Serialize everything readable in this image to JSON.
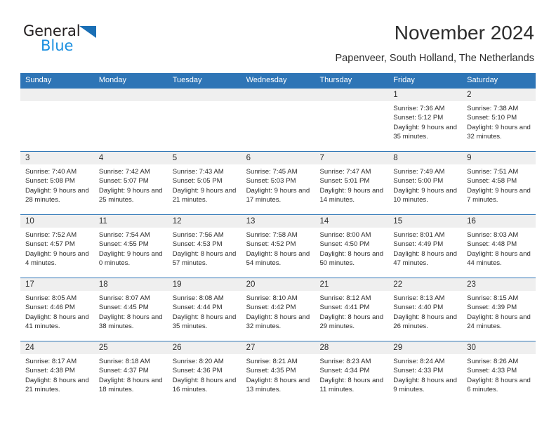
{
  "brand": {
    "name_part1": "General",
    "name_part2": "Blue",
    "triangle_icon": "triangle-icon",
    "color_dark": "#231f20",
    "color_blue": "#1a8fe0",
    "color_triangle": "#1a6fb5"
  },
  "header": {
    "title": "November 2024",
    "subtitle": "Papenveer, South Holland, The Netherlands"
  },
  "theme": {
    "header_bg": "#2e75b6",
    "date_strip_bg": "#efefef",
    "text": "#2c2c2c"
  },
  "weekdays": [
    "Sunday",
    "Monday",
    "Tuesday",
    "Wednesday",
    "Thursday",
    "Friday",
    "Saturday"
  ],
  "weeks": [
    [
      {
        "date": "",
        "sunrise": "",
        "sunset": "",
        "daylight": "",
        "empty": true
      },
      {
        "date": "",
        "sunrise": "",
        "sunset": "",
        "daylight": "",
        "empty": true
      },
      {
        "date": "",
        "sunrise": "",
        "sunset": "",
        "daylight": "",
        "empty": true
      },
      {
        "date": "",
        "sunrise": "",
        "sunset": "",
        "daylight": "",
        "empty": true
      },
      {
        "date": "",
        "sunrise": "",
        "sunset": "",
        "daylight": "",
        "empty": true
      },
      {
        "date": "1",
        "sunrise": "Sunrise: 7:36 AM",
        "sunset": "Sunset: 5:12 PM",
        "daylight": "Daylight: 9 hours and 35 minutes.",
        "empty": false
      },
      {
        "date": "2",
        "sunrise": "Sunrise: 7:38 AM",
        "sunset": "Sunset: 5:10 PM",
        "daylight": "Daylight: 9 hours and 32 minutes.",
        "empty": false
      }
    ],
    [
      {
        "date": "3",
        "sunrise": "Sunrise: 7:40 AM",
        "sunset": "Sunset: 5:08 PM",
        "daylight": "Daylight: 9 hours and 28 minutes.",
        "empty": false
      },
      {
        "date": "4",
        "sunrise": "Sunrise: 7:42 AM",
        "sunset": "Sunset: 5:07 PM",
        "daylight": "Daylight: 9 hours and 25 minutes.",
        "empty": false
      },
      {
        "date": "5",
        "sunrise": "Sunrise: 7:43 AM",
        "sunset": "Sunset: 5:05 PM",
        "daylight": "Daylight: 9 hours and 21 minutes.",
        "empty": false
      },
      {
        "date": "6",
        "sunrise": "Sunrise: 7:45 AM",
        "sunset": "Sunset: 5:03 PM",
        "daylight": "Daylight: 9 hours and 17 minutes.",
        "empty": false
      },
      {
        "date": "7",
        "sunrise": "Sunrise: 7:47 AM",
        "sunset": "Sunset: 5:01 PM",
        "daylight": "Daylight: 9 hours and 14 minutes.",
        "empty": false
      },
      {
        "date": "8",
        "sunrise": "Sunrise: 7:49 AM",
        "sunset": "Sunset: 5:00 PM",
        "daylight": "Daylight: 9 hours and 10 minutes.",
        "empty": false
      },
      {
        "date": "9",
        "sunrise": "Sunrise: 7:51 AM",
        "sunset": "Sunset: 4:58 PM",
        "daylight": "Daylight: 9 hours and 7 minutes.",
        "empty": false
      }
    ],
    [
      {
        "date": "10",
        "sunrise": "Sunrise: 7:52 AM",
        "sunset": "Sunset: 4:57 PM",
        "daylight": "Daylight: 9 hours and 4 minutes.",
        "empty": false
      },
      {
        "date": "11",
        "sunrise": "Sunrise: 7:54 AM",
        "sunset": "Sunset: 4:55 PM",
        "daylight": "Daylight: 9 hours and 0 minutes.",
        "empty": false
      },
      {
        "date": "12",
        "sunrise": "Sunrise: 7:56 AM",
        "sunset": "Sunset: 4:53 PM",
        "daylight": "Daylight: 8 hours and 57 minutes.",
        "empty": false
      },
      {
        "date": "13",
        "sunrise": "Sunrise: 7:58 AM",
        "sunset": "Sunset: 4:52 PM",
        "daylight": "Daylight: 8 hours and 54 minutes.",
        "empty": false
      },
      {
        "date": "14",
        "sunrise": "Sunrise: 8:00 AM",
        "sunset": "Sunset: 4:50 PM",
        "daylight": "Daylight: 8 hours and 50 minutes.",
        "empty": false
      },
      {
        "date": "15",
        "sunrise": "Sunrise: 8:01 AM",
        "sunset": "Sunset: 4:49 PM",
        "daylight": "Daylight: 8 hours and 47 minutes.",
        "empty": false
      },
      {
        "date": "16",
        "sunrise": "Sunrise: 8:03 AM",
        "sunset": "Sunset: 4:48 PM",
        "daylight": "Daylight: 8 hours and 44 minutes.",
        "empty": false
      }
    ],
    [
      {
        "date": "17",
        "sunrise": "Sunrise: 8:05 AM",
        "sunset": "Sunset: 4:46 PM",
        "daylight": "Daylight: 8 hours and 41 minutes.",
        "empty": false
      },
      {
        "date": "18",
        "sunrise": "Sunrise: 8:07 AM",
        "sunset": "Sunset: 4:45 PM",
        "daylight": "Daylight: 8 hours and 38 minutes.",
        "empty": false
      },
      {
        "date": "19",
        "sunrise": "Sunrise: 8:08 AM",
        "sunset": "Sunset: 4:44 PM",
        "daylight": "Daylight: 8 hours and 35 minutes.",
        "empty": false
      },
      {
        "date": "20",
        "sunrise": "Sunrise: 8:10 AM",
        "sunset": "Sunset: 4:42 PM",
        "daylight": "Daylight: 8 hours and 32 minutes.",
        "empty": false
      },
      {
        "date": "21",
        "sunrise": "Sunrise: 8:12 AM",
        "sunset": "Sunset: 4:41 PM",
        "daylight": "Daylight: 8 hours and 29 minutes.",
        "empty": false
      },
      {
        "date": "22",
        "sunrise": "Sunrise: 8:13 AM",
        "sunset": "Sunset: 4:40 PM",
        "daylight": "Daylight: 8 hours and 26 minutes.",
        "empty": false
      },
      {
        "date": "23",
        "sunrise": "Sunrise: 8:15 AM",
        "sunset": "Sunset: 4:39 PM",
        "daylight": "Daylight: 8 hours and 24 minutes.",
        "empty": false
      }
    ],
    [
      {
        "date": "24",
        "sunrise": "Sunrise: 8:17 AM",
        "sunset": "Sunset: 4:38 PM",
        "daylight": "Daylight: 8 hours and 21 minutes.",
        "empty": false
      },
      {
        "date": "25",
        "sunrise": "Sunrise: 8:18 AM",
        "sunset": "Sunset: 4:37 PM",
        "daylight": "Daylight: 8 hours and 18 minutes.",
        "empty": false
      },
      {
        "date": "26",
        "sunrise": "Sunrise: 8:20 AM",
        "sunset": "Sunset: 4:36 PM",
        "daylight": "Daylight: 8 hours and 16 minutes.",
        "empty": false
      },
      {
        "date": "27",
        "sunrise": "Sunrise: 8:21 AM",
        "sunset": "Sunset: 4:35 PM",
        "daylight": "Daylight: 8 hours and 13 minutes.",
        "empty": false
      },
      {
        "date": "28",
        "sunrise": "Sunrise: 8:23 AM",
        "sunset": "Sunset: 4:34 PM",
        "daylight": "Daylight: 8 hours and 11 minutes.",
        "empty": false
      },
      {
        "date": "29",
        "sunrise": "Sunrise: 8:24 AM",
        "sunset": "Sunset: 4:33 PM",
        "daylight": "Daylight: 8 hours and 9 minutes.",
        "empty": false
      },
      {
        "date": "30",
        "sunrise": "Sunrise: 8:26 AM",
        "sunset": "Sunset: 4:33 PM",
        "daylight": "Daylight: 8 hours and 6 minutes.",
        "empty": false
      }
    ]
  ]
}
